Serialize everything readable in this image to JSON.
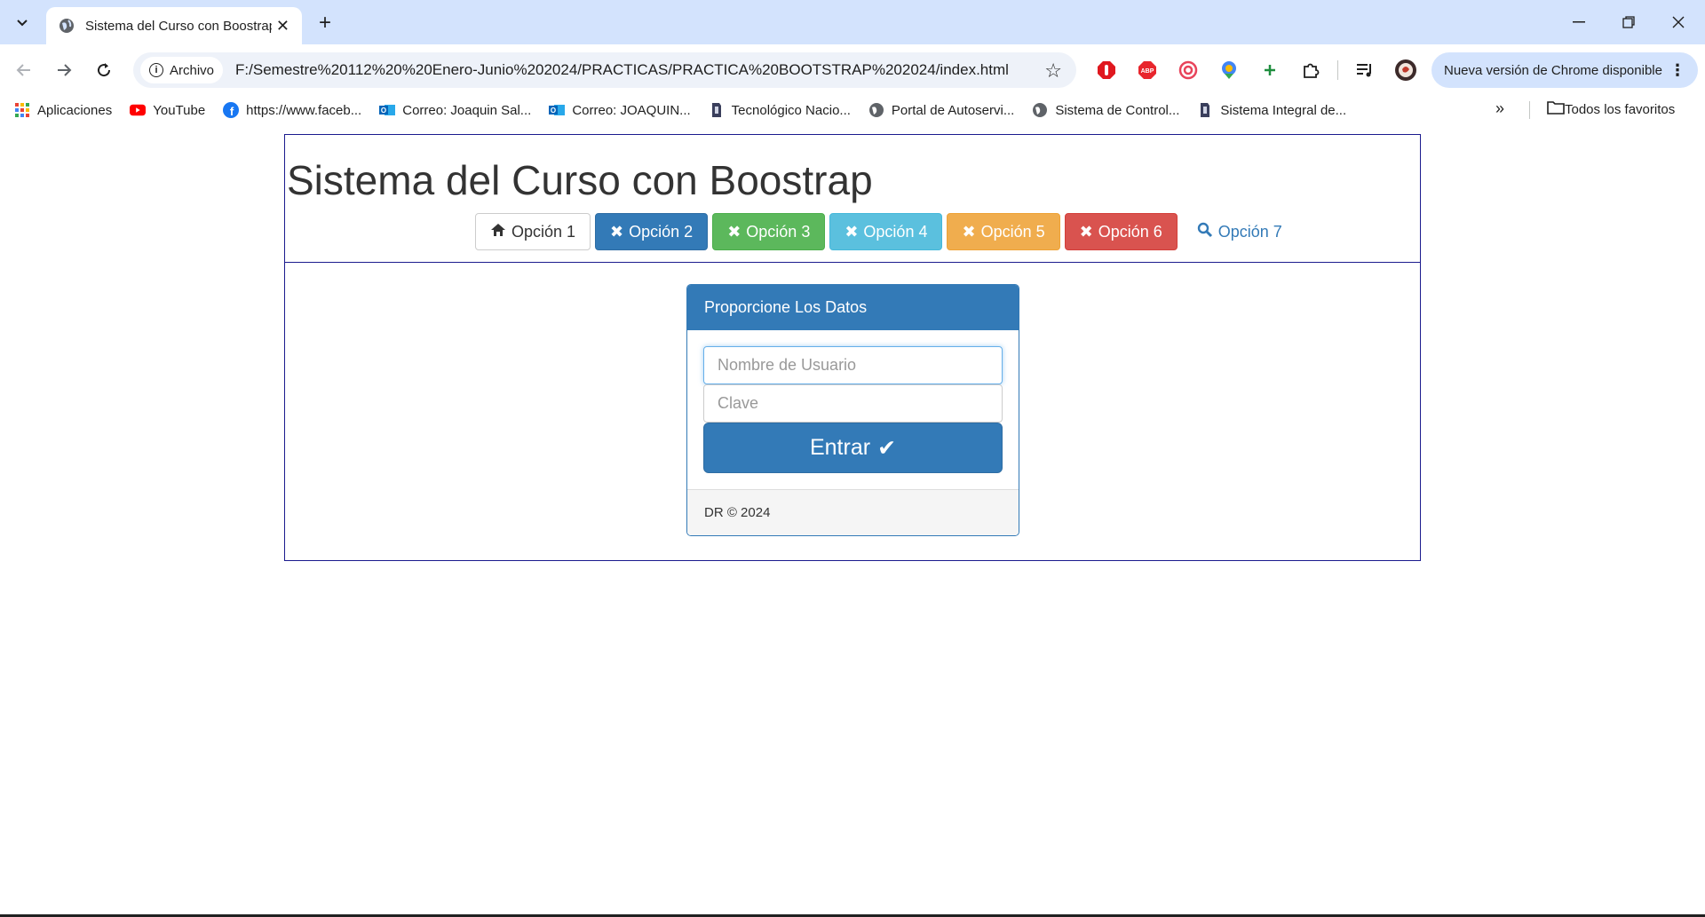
{
  "browser": {
    "tab_title": "Sistema del Curso con Boostrap",
    "tab_close": "✕",
    "new_tab": "+",
    "window": {
      "minimize": "—",
      "restore": "❐",
      "close": "✕"
    },
    "site_info_label": "Archivo",
    "url": "F:/Semestre%20112%20%20Enero-Junio%202024/PRACTICAS/PRACTICA%20BOOTSTRAP%202024/index.html",
    "update_button": "Nueva versión de Chrome disponible",
    "bookmarks": [
      {
        "label": "Aplicaciones",
        "icon": "apps-grid-icon"
      },
      {
        "label": "YouTube",
        "icon": "youtube-icon"
      },
      {
        "label": "https://www.faceb...",
        "icon": "facebook-icon"
      },
      {
        "label": "Correo: Joaquin Sal...",
        "icon": "outlook-icon"
      },
      {
        "label": "Correo: JOAQUIN...",
        "icon": "outlook-icon"
      },
      {
        "label": "Tecnológico Nacio...",
        "icon": "tecnm-icon"
      },
      {
        "label": "Portal de Autoservi...",
        "icon": "globe-icon"
      },
      {
        "label": "Sistema de Control...",
        "icon": "globe-icon"
      },
      {
        "label": "Sistema Integral de...",
        "icon": "tecnm-icon"
      }
    ],
    "bookmarks_more": "»",
    "all_bookmarks": "Todos los favoritos"
  },
  "page": {
    "title": "Sistema del Curso con Boostrap",
    "nav_buttons": [
      {
        "label": "Opción 1",
        "glyph": "⌂",
        "style": "default",
        "icon": "home-icon"
      },
      {
        "label": "Opción 2",
        "glyph": "✖",
        "style": "primary",
        "icon": "remove-icon"
      },
      {
        "label": "Opción 3",
        "glyph": "✖",
        "style": "success",
        "icon": "remove-icon"
      },
      {
        "label": "Opción 4",
        "glyph": "✖",
        "style": "info",
        "icon": "remove-icon"
      },
      {
        "label": "Opción 5",
        "glyph": "✖",
        "style": "warning",
        "icon": "remove-icon"
      },
      {
        "label": "Opción 6",
        "glyph": "✖",
        "style": "danger",
        "icon": "remove-icon"
      },
      {
        "label": "Opción 7",
        "glyph": "🔍",
        "style": "link",
        "icon": "search-icon"
      }
    ],
    "login_panel": {
      "heading": "Proporcione Los Datos",
      "username_placeholder": "Nombre de Usuario",
      "password_placeholder": "Clave",
      "submit_label": "Entrar",
      "submit_glyph": "✔",
      "footer": "DR © 2024"
    }
  },
  "colors": {
    "primary": "#337ab7",
    "success": "#5cb85c",
    "info": "#5bc0de",
    "warning": "#f0ad4e",
    "danger": "#d9534f",
    "frame_border": "#1b1b8e"
  }
}
